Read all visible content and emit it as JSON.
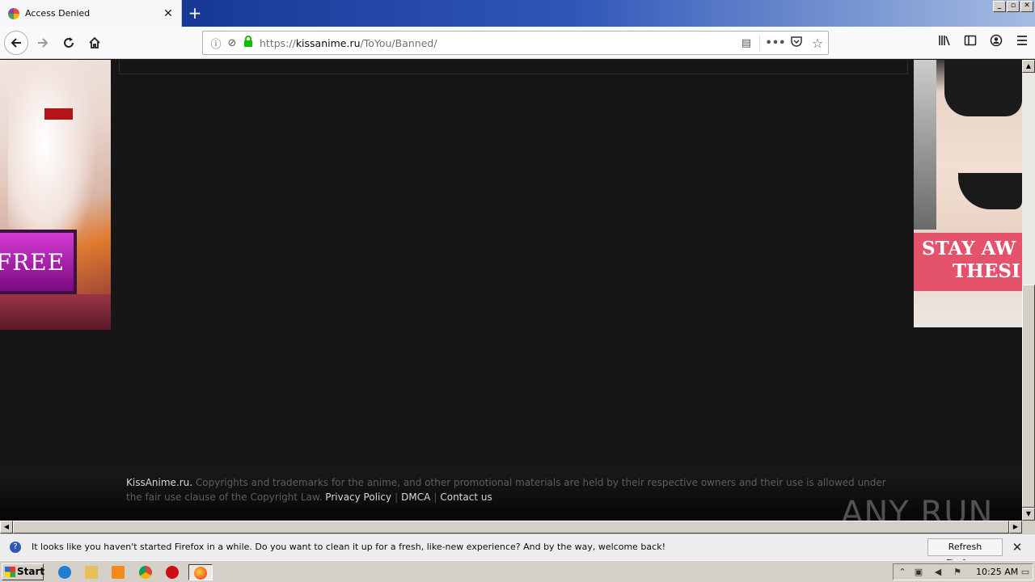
{
  "tab": {
    "title": "Access Denied",
    "close": "✕",
    "new_tab": "+"
  },
  "window_controls": {
    "minimize": "_",
    "restore": "▫",
    "close": "✕"
  },
  "address_bar": {
    "url_prefix": "https://",
    "url_domain": "kissanime.ru",
    "url_path": "/ToYou/Banned/"
  },
  "ads": {
    "left_text": "FREE",
    "right_line1": "STAY AW",
    "right_line2": "THESI"
  },
  "footer": {
    "brand": "KissAnime.ru.",
    "text": " Copyrights and trademarks for the anime, and other promotional materials are held by their respective owners and their use is allowed under the fair use clause of the Copyright Law.",
    "links": {
      "privacy": "Privacy Policy",
      "dmca": "DMCA",
      "contact": "Contact us"
    },
    "separator": "|"
  },
  "watermark": "ANY RUN",
  "notification": {
    "message": "It looks like you haven't started Firefox in a while. Do you want to clean it up for a fresh, like-new experience? And by the way, welcome back!",
    "button": "Refresh Firefox...",
    "close": "✕"
  },
  "taskbar": {
    "start": "Start",
    "clock": "10:25 AM"
  }
}
